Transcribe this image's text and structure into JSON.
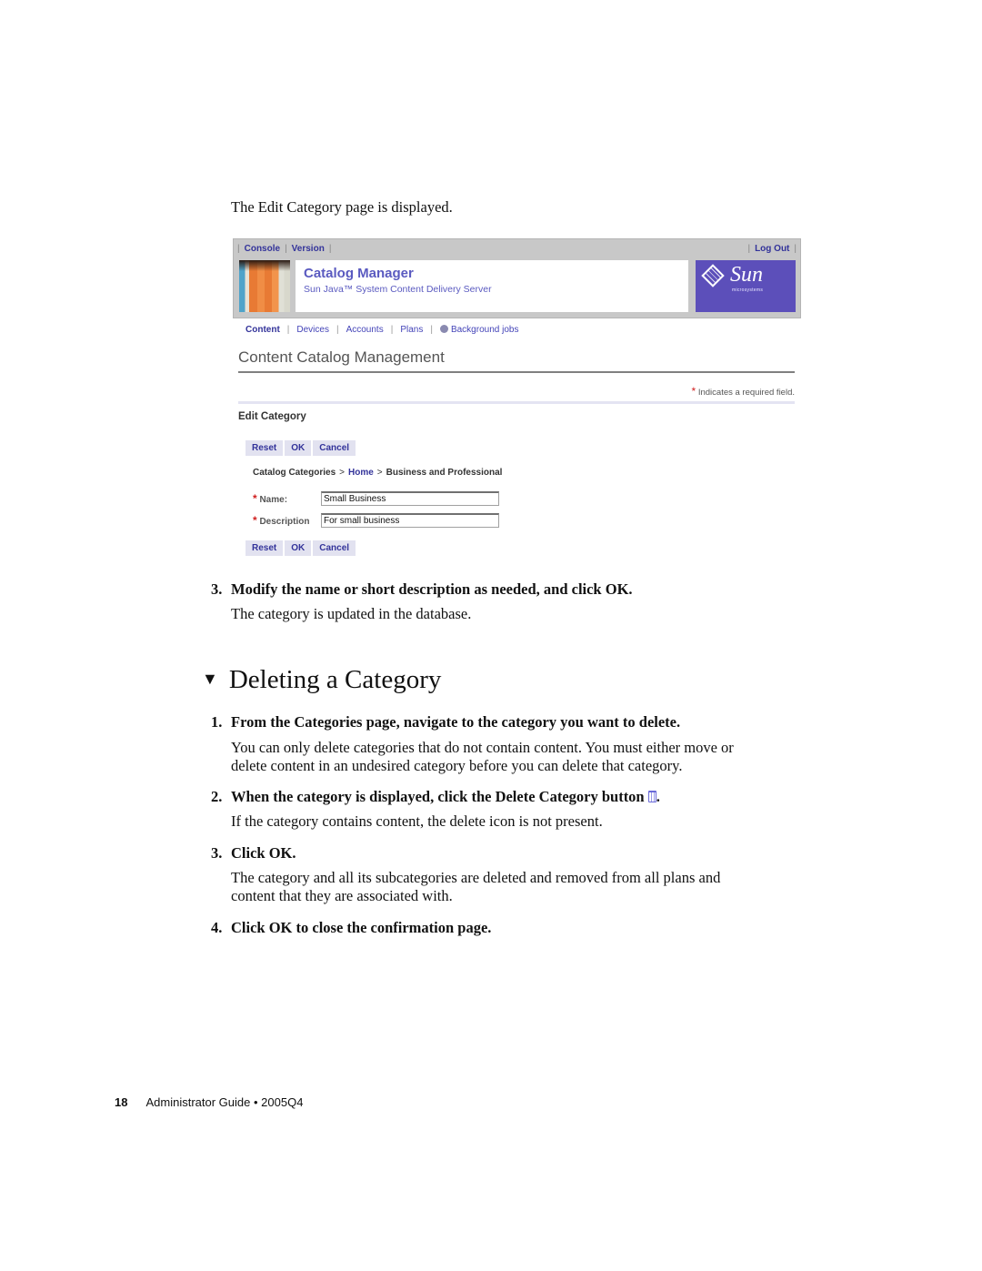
{
  "intro_text": "The Edit Category page is displayed.",
  "screenshot": {
    "util_nav_left": [
      "Console",
      "Version"
    ],
    "util_nav_right": [
      "Log Out"
    ],
    "brand_title": "Catalog Manager",
    "brand_subtitle": "Sun Java™ System Content Delivery Server",
    "logo_word": "Sun",
    "logo_sub": "microsystems",
    "tabs": [
      {
        "label": "Content",
        "active": true
      },
      {
        "label": "Devices",
        "active": false
      },
      {
        "label": "Accounts",
        "active": false
      },
      {
        "label": "Plans",
        "active": false
      },
      {
        "label": "Background jobs",
        "active": false,
        "icon": "globe-icon"
      }
    ],
    "page_title": "Content Catalog Management",
    "required_star": "*",
    "required_note": "Indicates a required field.",
    "section_title": "Edit Category",
    "buttons": {
      "reset": "Reset",
      "ok": "OK",
      "cancel": "Cancel"
    },
    "breadcrumb": {
      "items": [
        "Catalog Categories",
        "Home",
        "Business and Professional"
      ],
      "separator": ">"
    },
    "fields": [
      {
        "label": "Name:",
        "value": "Small Business",
        "required": true
      },
      {
        "label": "Description",
        "value": "For small business",
        "required": true
      }
    ]
  },
  "steps_before": [
    {
      "num": "3.",
      "text": "Modify the name or short description as needed, and click OK.",
      "body": "The category is updated in the database."
    }
  ],
  "section_heading": "Deleting a Category",
  "section_marker": "▼",
  "steps": [
    {
      "num": "1.",
      "text": "From the Categories page, navigate to the category you want to delete.",
      "body_lines": [
        "You can only delete categories that do not contain content. You must either move or",
        "delete content in an undesired category before you can delete that category."
      ]
    },
    {
      "num": "2.",
      "text": "When the category is displayed, click the Delete Category button",
      "text_suffix": ".",
      "icon": "trash-icon",
      "body_lines": [
        "If the category contains content, the delete icon is not present."
      ]
    },
    {
      "num": "3.",
      "text": "Click OK.",
      "body_lines": [
        "The category and all its subcategories are deleted and removed from all plans and",
        "content that they are associated with."
      ]
    },
    {
      "num": "4.",
      "text": "Click OK to close the confirmation page.",
      "body_lines": []
    }
  ],
  "footer": {
    "page_number": "18",
    "book_title": "Administrator Guide",
    "bullet": "•",
    "edition": "2005Q4"
  },
  "colors": {
    "link_blue": "#33339a",
    "button_bg": "#e2e2f0",
    "logo_bg": "#5c4fba",
    "required_red": "#d02020",
    "masthead_gray": "#c8c8c8"
  }
}
